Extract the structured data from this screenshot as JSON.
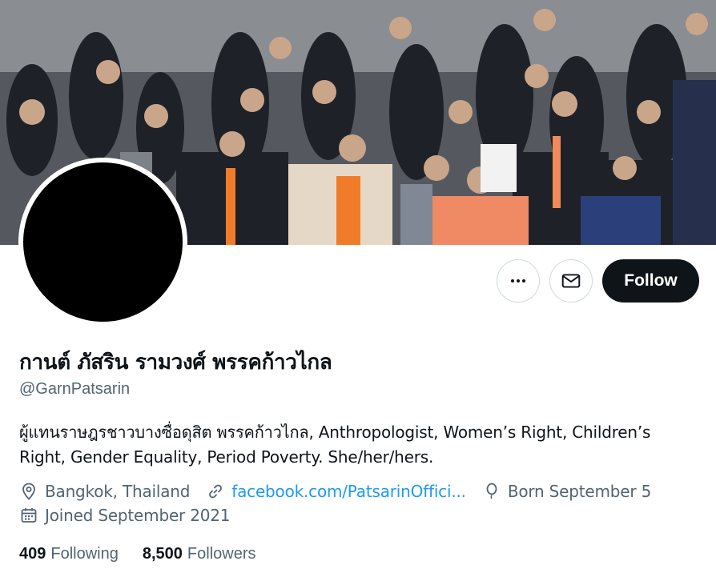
{
  "profile": {
    "display_name": "กานต์ ภัสริน รามวงศ์ พรรคก้าวไกล",
    "handle": "@GarnPatsarin",
    "bio": "ผู้แทนราษฎรชาวบางซื่อดุสิต พรรคก้าวไกล, Anthropologist, Women’s Right, Children’s Right, Gender Equality, Period Poverty. She/her/hers.",
    "location": "Bangkok, Thailand",
    "website": "facebook.com/PatsarinOffici...",
    "birthday": "Born September 5",
    "joined": "Joined September 2021"
  },
  "actions": {
    "follow_label": "Follow"
  },
  "stats": {
    "following_count": "409",
    "following_label": "Following",
    "followers_count": "8,500",
    "followers_label": "Followers"
  },
  "icons": {
    "more": "more-icon",
    "message": "mail-icon",
    "location": "location-pin-icon",
    "link": "link-icon",
    "birthday": "balloon-icon",
    "joined": "calendar-icon"
  },
  "colors": {
    "link": "#1d9bf0",
    "muted": "#536471",
    "primary_text": "#0f1419",
    "follow_bg": "#0f1419"
  }
}
